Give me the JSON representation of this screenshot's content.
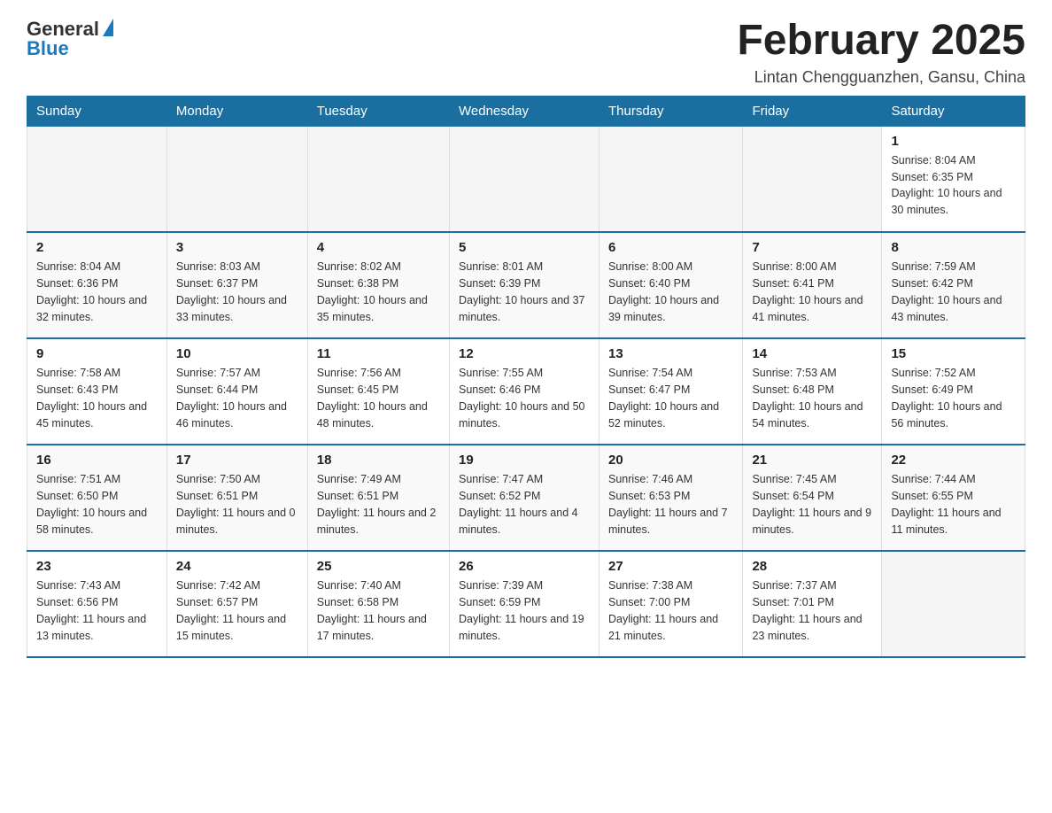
{
  "header": {
    "logo_general": "General",
    "logo_blue": "Blue",
    "month_title": "February 2025",
    "subtitle": "Lintan Chengguanzhen, Gansu, China"
  },
  "weekdays": [
    "Sunday",
    "Monday",
    "Tuesday",
    "Wednesday",
    "Thursday",
    "Friday",
    "Saturday"
  ],
  "weeks": [
    [
      {
        "day": "",
        "info": ""
      },
      {
        "day": "",
        "info": ""
      },
      {
        "day": "",
        "info": ""
      },
      {
        "day": "",
        "info": ""
      },
      {
        "day": "",
        "info": ""
      },
      {
        "day": "",
        "info": ""
      },
      {
        "day": "1",
        "info": "Sunrise: 8:04 AM\nSunset: 6:35 PM\nDaylight: 10 hours and 30 minutes."
      }
    ],
    [
      {
        "day": "2",
        "info": "Sunrise: 8:04 AM\nSunset: 6:36 PM\nDaylight: 10 hours and 32 minutes."
      },
      {
        "day": "3",
        "info": "Sunrise: 8:03 AM\nSunset: 6:37 PM\nDaylight: 10 hours and 33 minutes."
      },
      {
        "day": "4",
        "info": "Sunrise: 8:02 AM\nSunset: 6:38 PM\nDaylight: 10 hours and 35 minutes."
      },
      {
        "day": "5",
        "info": "Sunrise: 8:01 AM\nSunset: 6:39 PM\nDaylight: 10 hours and 37 minutes."
      },
      {
        "day": "6",
        "info": "Sunrise: 8:00 AM\nSunset: 6:40 PM\nDaylight: 10 hours and 39 minutes."
      },
      {
        "day": "7",
        "info": "Sunrise: 8:00 AM\nSunset: 6:41 PM\nDaylight: 10 hours and 41 minutes."
      },
      {
        "day": "8",
        "info": "Sunrise: 7:59 AM\nSunset: 6:42 PM\nDaylight: 10 hours and 43 minutes."
      }
    ],
    [
      {
        "day": "9",
        "info": "Sunrise: 7:58 AM\nSunset: 6:43 PM\nDaylight: 10 hours and 45 minutes."
      },
      {
        "day": "10",
        "info": "Sunrise: 7:57 AM\nSunset: 6:44 PM\nDaylight: 10 hours and 46 minutes."
      },
      {
        "day": "11",
        "info": "Sunrise: 7:56 AM\nSunset: 6:45 PM\nDaylight: 10 hours and 48 minutes."
      },
      {
        "day": "12",
        "info": "Sunrise: 7:55 AM\nSunset: 6:46 PM\nDaylight: 10 hours and 50 minutes."
      },
      {
        "day": "13",
        "info": "Sunrise: 7:54 AM\nSunset: 6:47 PM\nDaylight: 10 hours and 52 minutes."
      },
      {
        "day": "14",
        "info": "Sunrise: 7:53 AM\nSunset: 6:48 PM\nDaylight: 10 hours and 54 minutes."
      },
      {
        "day": "15",
        "info": "Sunrise: 7:52 AM\nSunset: 6:49 PM\nDaylight: 10 hours and 56 minutes."
      }
    ],
    [
      {
        "day": "16",
        "info": "Sunrise: 7:51 AM\nSunset: 6:50 PM\nDaylight: 10 hours and 58 minutes."
      },
      {
        "day": "17",
        "info": "Sunrise: 7:50 AM\nSunset: 6:51 PM\nDaylight: 11 hours and 0 minutes."
      },
      {
        "day": "18",
        "info": "Sunrise: 7:49 AM\nSunset: 6:51 PM\nDaylight: 11 hours and 2 minutes."
      },
      {
        "day": "19",
        "info": "Sunrise: 7:47 AM\nSunset: 6:52 PM\nDaylight: 11 hours and 4 minutes."
      },
      {
        "day": "20",
        "info": "Sunrise: 7:46 AM\nSunset: 6:53 PM\nDaylight: 11 hours and 7 minutes."
      },
      {
        "day": "21",
        "info": "Sunrise: 7:45 AM\nSunset: 6:54 PM\nDaylight: 11 hours and 9 minutes."
      },
      {
        "day": "22",
        "info": "Sunrise: 7:44 AM\nSunset: 6:55 PM\nDaylight: 11 hours and 11 minutes."
      }
    ],
    [
      {
        "day": "23",
        "info": "Sunrise: 7:43 AM\nSunset: 6:56 PM\nDaylight: 11 hours and 13 minutes."
      },
      {
        "day": "24",
        "info": "Sunrise: 7:42 AM\nSunset: 6:57 PM\nDaylight: 11 hours and 15 minutes."
      },
      {
        "day": "25",
        "info": "Sunrise: 7:40 AM\nSunset: 6:58 PM\nDaylight: 11 hours and 17 minutes."
      },
      {
        "day": "26",
        "info": "Sunrise: 7:39 AM\nSunset: 6:59 PM\nDaylight: 11 hours and 19 minutes."
      },
      {
        "day": "27",
        "info": "Sunrise: 7:38 AM\nSunset: 7:00 PM\nDaylight: 11 hours and 21 minutes."
      },
      {
        "day": "28",
        "info": "Sunrise: 7:37 AM\nSunset: 7:01 PM\nDaylight: 11 hours and 23 minutes."
      },
      {
        "day": "",
        "info": ""
      }
    ]
  ]
}
